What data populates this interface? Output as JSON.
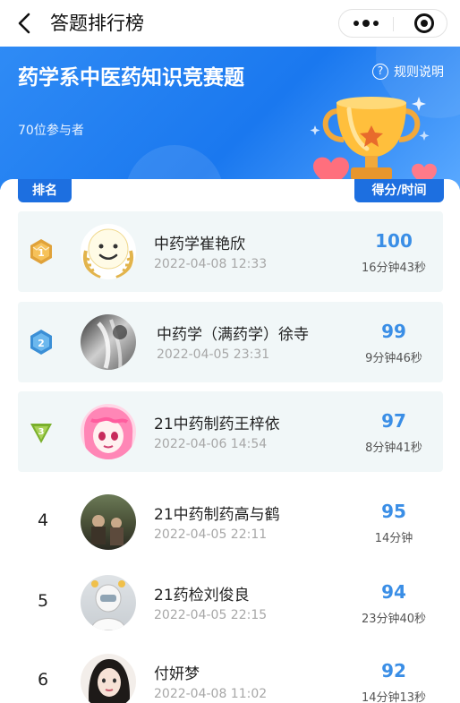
{
  "nav": {
    "title": "答题排行榜"
  },
  "banner": {
    "title": "药学系中医药知识竞赛题",
    "participants": "70位参与者",
    "rules_label": "规则说明",
    "rules_icon": "?"
  },
  "table": {
    "rank_header": "排名",
    "score_header": "得分/时间"
  },
  "rows": [
    {
      "rank": "1",
      "name": "中药学崔艳欣",
      "date": "2022-04-08 12:33",
      "score": "100",
      "time": "16分钟43秒"
    },
    {
      "rank": "2",
      "name": "中药学（满药学）徐寺",
      "date": "2022-04-05 23:31",
      "score": "99",
      "time": "9分钟46秒"
    },
    {
      "rank": "3",
      "name": "21中药制药王梓依",
      "date": "2022-04-06 14:54",
      "score": "97",
      "time": "8分钟41秒"
    },
    {
      "rank": "4",
      "name": "21中药制药高与鹤",
      "date": "2022-04-05 22:11",
      "score": "95",
      "time": "14分钟"
    },
    {
      "rank": "5",
      "name": "21药检刘俊良",
      "date": "2022-04-05 22:15",
      "score": "94",
      "time": "23分钟40秒"
    },
    {
      "rank": "6",
      "name": "付妍梦",
      "date": "2022-04-08 11:02",
      "score": "92",
      "time": "14分钟13秒"
    }
  ],
  "colors": {
    "accent": "#1d6fe0",
    "score": "#3a8ee6",
    "top_row_bg": "#f1f7f8",
    "gold": "#e0a23a",
    "silver": "#4aa3e0",
    "bronze": "#8cbf3a"
  }
}
